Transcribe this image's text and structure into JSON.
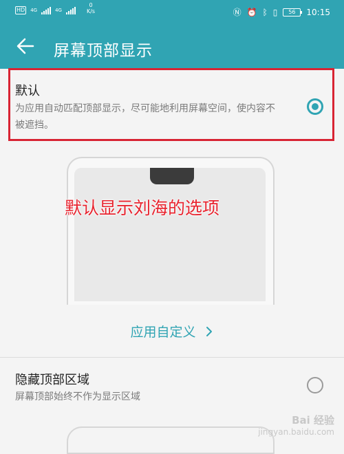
{
  "status_bar": {
    "hd": "HD",
    "sig1": "4G",
    "sig2": "4G",
    "speed_val": "0",
    "speed_unit": "K/s",
    "battery": "56",
    "time": "10:15"
  },
  "header": {
    "title": "屏幕顶部显示"
  },
  "options": {
    "default": {
      "title": "默认",
      "desc": "为应用自动匹配顶部显示，尽可能地利用屏幕空间，使内容不被遮挡。",
      "selected": true
    },
    "hide": {
      "title": "隐藏顶部区域",
      "desc": "屏幕顶部始终不作为显示区域",
      "selected": false
    }
  },
  "annotation": "默认显示刘海的选项",
  "custom_link": "应用自定义",
  "watermark": {
    "main": "Bai 经验",
    "sub": "jingyan.baidu.com"
  },
  "colors": {
    "accent": "#30a4b3",
    "highlight": "#d82433",
    "annotation": "#e8242f"
  },
  "icons": {
    "back": "arrow-left-icon",
    "chevron": "chevron-right-icon"
  }
}
